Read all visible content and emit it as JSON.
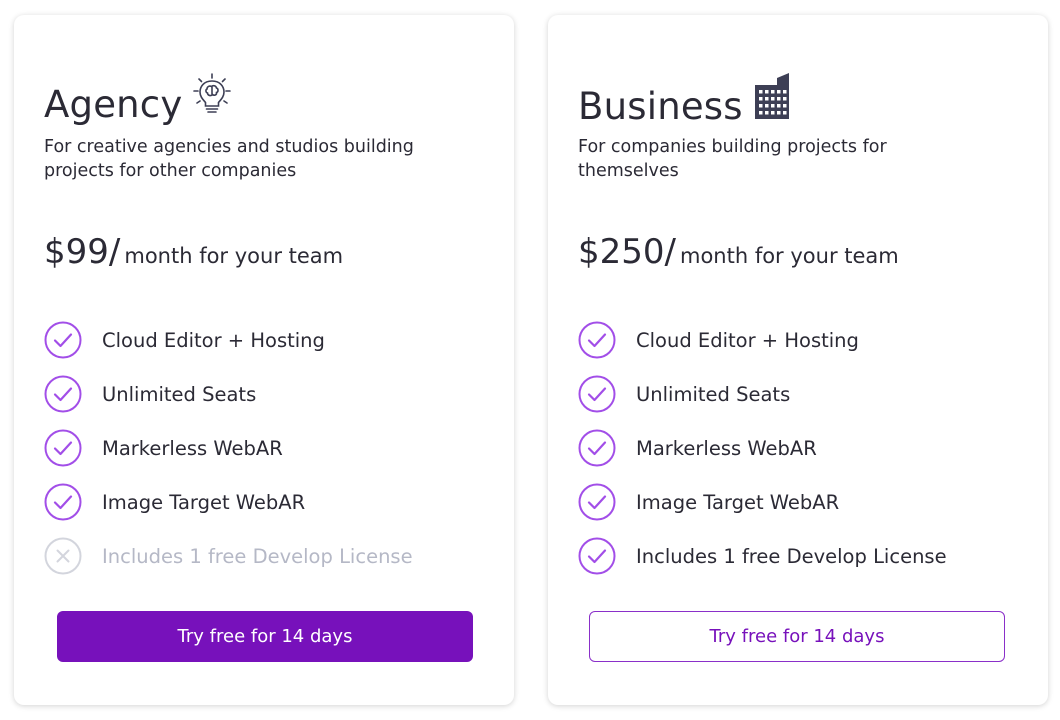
{
  "colors": {
    "accent": "#7711bb",
    "check": "#a24ee8",
    "disabled": "#b5b8c6",
    "text": "#2b2a35"
  },
  "plans": [
    {
      "title": "Agency",
      "icon": "lightbulb-icon",
      "description": "For creative agencies and studios building projects for other companies",
      "price": "$99/",
      "price_suffix": "month for your team",
      "features": [
        {
          "label": "Cloud Editor + Hosting",
          "included": true
        },
        {
          "label": "Unlimited Seats",
          "included": true
        },
        {
          "label": "Markerless WebAR",
          "included": true
        },
        {
          "label": "Image Target WebAR",
          "included": true
        },
        {
          "label": "Includes 1 free Develop License",
          "included": false
        }
      ],
      "cta": "Try free for 14 days"
    },
    {
      "title": "Business",
      "icon": "office-building-icon",
      "description": "For companies building projects for themselves",
      "price": "$250/",
      "price_suffix": "month for your team",
      "features": [
        {
          "label": "Cloud Editor + Hosting",
          "included": true
        },
        {
          "label": "Unlimited Seats",
          "included": true
        },
        {
          "label": "Markerless WebAR",
          "included": true
        },
        {
          "label": "Image Target WebAR",
          "included": true
        },
        {
          "label": "Includes 1 free Develop License",
          "included": true
        }
      ],
      "cta": "Try free for 14 days"
    }
  ]
}
